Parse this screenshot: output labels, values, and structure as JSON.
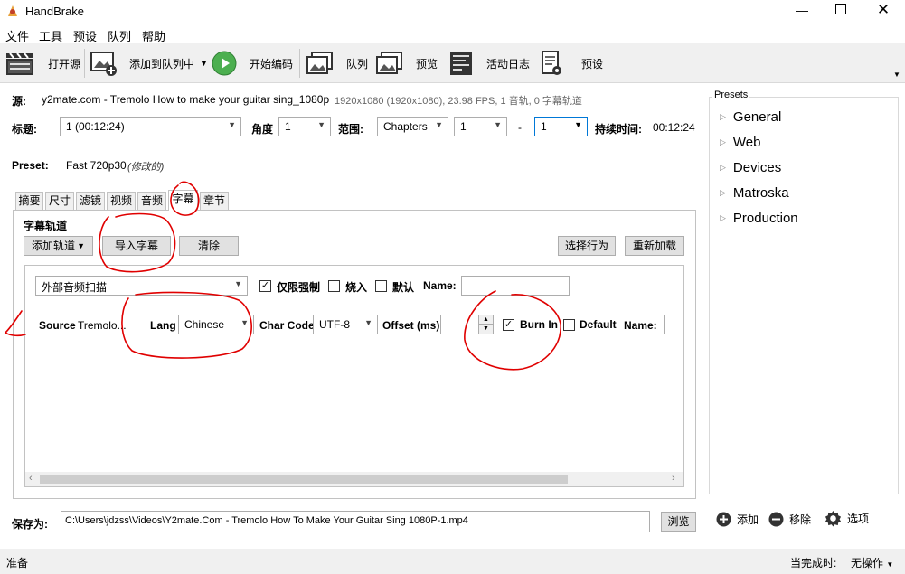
{
  "app": {
    "title": "HandBrake"
  },
  "menu": [
    "文件",
    "工具",
    "预设",
    "队列",
    "帮助"
  ],
  "toolbar": {
    "open_source": "打开源",
    "add_queue": "添加到队列中",
    "start_encode": "开始编码",
    "queue": "队列",
    "preview": "预览",
    "activity_log": "活动日志",
    "presets": "预设"
  },
  "source": {
    "label": "源:",
    "name": "y2mate.com - Tremolo How to make your guitar sing_1080p",
    "info": "1920x1080 (1920x1080), 23.98 FPS, 1 音轨, 0 字幕轨道"
  },
  "title_row": {
    "title_label": "标题:",
    "title_value": "1 (00:12:24)",
    "angle_label": "角度",
    "angle_value": "1",
    "range_label": "范围:",
    "range_type": "Chapters",
    "range_start": "1",
    "range_dash": "-",
    "range_end": "1",
    "duration_label": "持续时间:",
    "duration_value": "00:12:24"
  },
  "preset": {
    "label": "Preset:",
    "name": "Fast 720p30",
    "modified": "(修改的)"
  },
  "tabs": [
    "摘要",
    "尺寸",
    "滤镜",
    "视频",
    "音频",
    "字幕",
    "章节"
  ],
  "subtitles": {
    "group_title": "字幕轨道",
    "add_track": "添加轨道",
    "import": "导入字幕",
    "clear": "清除",
    "select_behavior": "选择行为",
    "reload": "重新加载",
    "row1": {
      "track": "外部音频扫描",
      "forced_only": "仅限强制",
      "burn": "烧入",
      "default": "默认",
      "name_label": "Name:"
    },
    "row2": {
      "source_label": "Source",
      "source_value": "Tremolo...",
      "lang_label": "Lang",
      "lang_value": "Chinese",
      "charcode_label": "Char Code",
      "charcode_value": "UTF-8",
      "offset_label": "Offset (ms)",
      "burnin_label": "Burn In",
      "default_label": "Default",
      "name_label": "Name:"
    }
  },
  "save": {
    "label": "保存为:",
    "path": "C:\\Users\\jdzss\\Videos\\Y2mate.Com - Tremolo How To Make Your Guitar Sing 1080P-1.mp4",
    "browse": "浏览"
  },
  "presets_panel": {
    "title": "Presets",
    "items": [
      "General",
      "Web",
      "Devices",
      "Matroska",
      "Production"
    ],
    "add": "添加",
    "remove": "移除",
    "options": "选项"
  },
  "status": {
    "left": "准备",
    "when_done_label": "当完成时:",
    "when_done_value": "无操作"
  },
  "colors": {
    "accent_focus": "#0078d7",
    "annotation": "#e00000",
    "play_green": "#4caf50"
  }
}
